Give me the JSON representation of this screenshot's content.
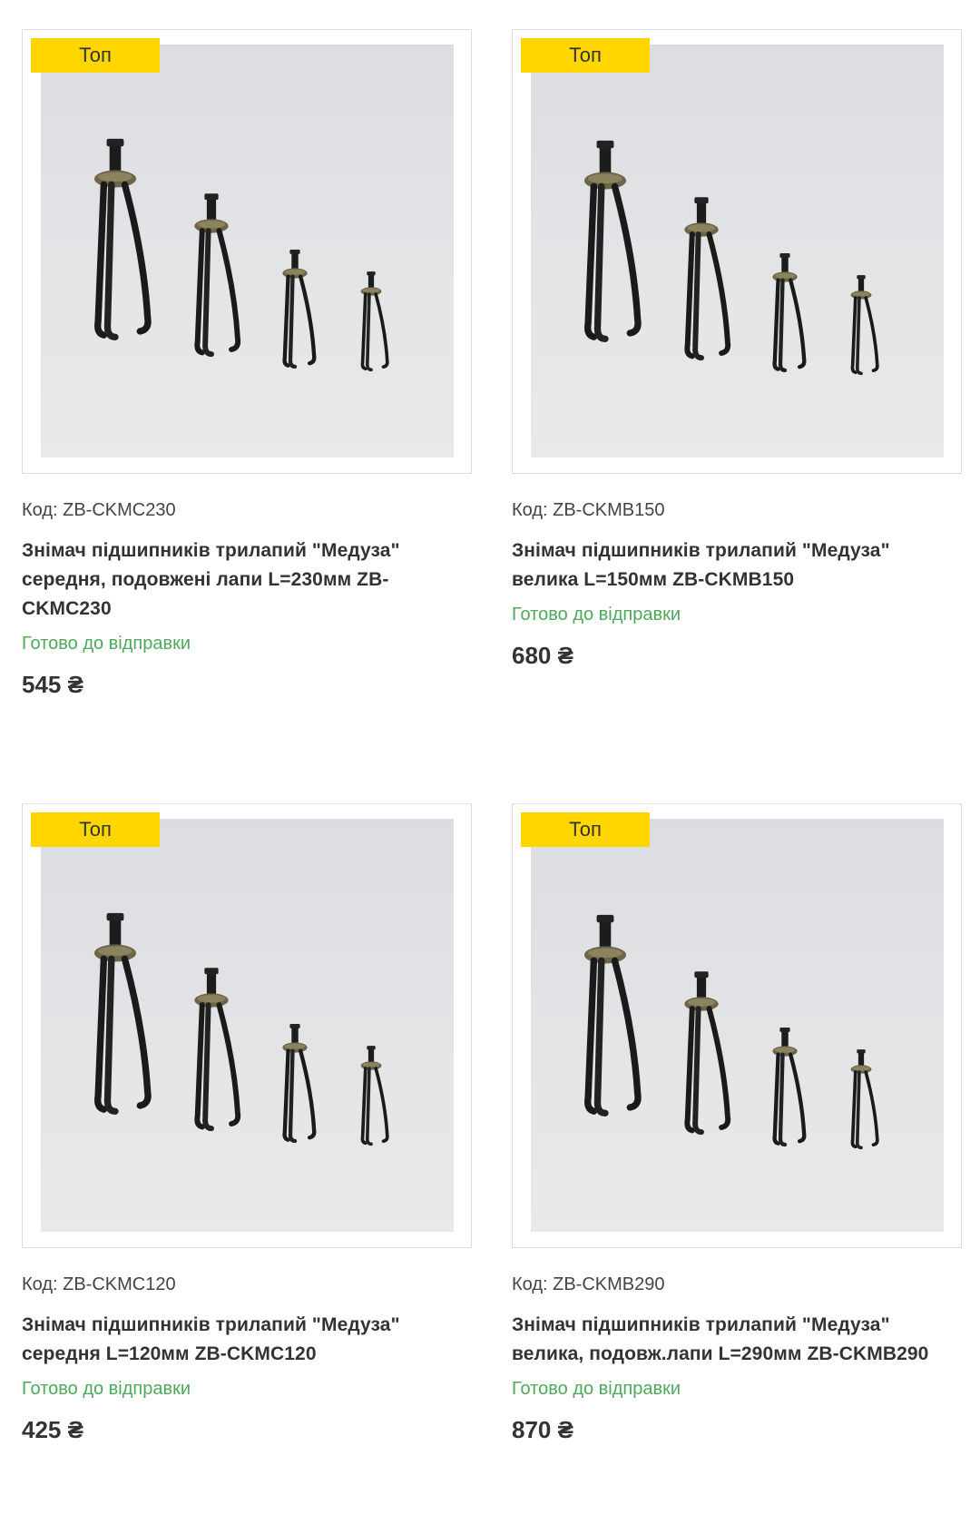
{
  "products": [
    {
      "badge": "Топ",
      "image_icon": "bearing-puller-set-photo",
      "code": "Код: ZB-CKMC230",
      "title": "Знімач підшипників трилапий \"Медуза\" середня, подовжені лапи L=230мм ZB-CKMC230",
      "status": "Готово до відправки",
      "price": "545 ₴"
    },
    {
      "badge": "Топ",
      "image_icon": "bearing-puller-set-photo",
      "code": "Код: ZB-CKMB150",
      "title": "Знімач підшипників трилапий \"Медуза\" велика L=150мм ZB-CKMB150",
      "status": "Готово до відправки",
      "price": "680 ₴"
    },
    {
      "badge": "Топ",
      "image_icon": "bearing-puller-set-photo",
      "code": "Код: ZB-CKMC120",
      "title": "Знімач підшипників трилапий \"Медуза\" середня L=120мм ZB-CKMC120",
      "status": "Готово до відправки",
      "price": "425 ₴"
    },
    {
      "badge": "Топ",
      "image_icon": "bearing-puller-set-photo",
      "code": "Код: ZB-CKMB290",
      "title": "Знімач підшипників трилапий \"Медуза\" велика, подовж.лапи L=290мм ZB-CKMB290",
      "status": "Готово до відправки",
      "price": "870 ₴"
    }
  ],
  "colors": {
    "badge_bg": "#ffd600",
    "status_green": "#4ea95a",
    "text": "#333333",
    "border": "#dedede"
  }
}
